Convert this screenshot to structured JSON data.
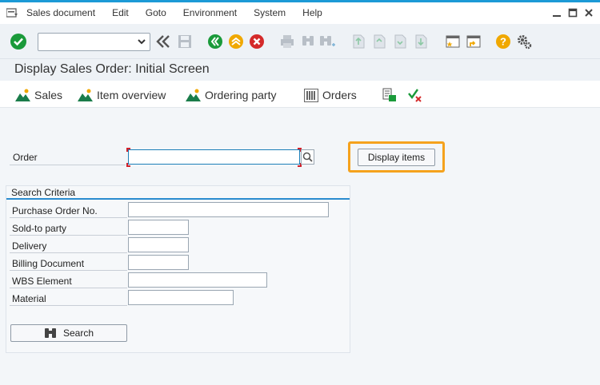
{
  "menu": {
    "items": [
      {
        "label": "Sales document"
      },
      {
        "label": "Edit"
      },
      {
        "label": "Goto"
      },
      {
        "label": "Environment"
      },
      {
        "label": "System"
      },
      {
        "label": "Help"
      }
    ]
  },
  "toolbar": {
    "command_field": {
      "value": ""
    },
    "icons": [
      "enter-icon",
      "back-navigation-icon",
      "save-icon",
      "back-icon",
      "exit-icon",
      "cancel-icon",
      "print-icon",
      "find-icon",
      "find-next-icon",
      "first-page-icon",
      "previous-page-icon",
      "next-page-icon",
      "last-page-icon",
      "create-session-icon",
      "create-shortcut-icon",
      "help-icon",
      "customize-layout-icon"
    ]
  },
  "title": "Display Sales Order: Initial Screen",
  "app_toolbar": {
    "sales": "Sales",
    "item_overview": "Item overview",
    "ordering_party": "Ordering party",
    "orders": "Orders"
  },
  "order": {
    "label": "Order",
    "value": ""
  },
  "display_items": "Display items",
  "search_criteria": {
    "title": "Search Criteria",
    "fields": [
      {
        "label": "Purchase Order No.",
        "value": ""
      },
      {
        "label": "Sold-to party",
        "value": ""
      },
      {
        "label": "Delivery",
        "value": ""
      },
      {
        "label": "Billing Document",
        "value": ""
      },
      {
        "label": "WBS Element",
        "value": ""
      },
      {
        "label": "Material",
        "value": ""
      }
    ],
    "search_button": "Search"
  },
  "colors": {
    "accent_blue": "#1c9ad6",
    "highlight_orange": "#f5a21d",
    "enter_green": "#1a9a3a",
    "cancel_red": "#d42a2a",
    "help_yellow": "#f0a800"
  }
}
